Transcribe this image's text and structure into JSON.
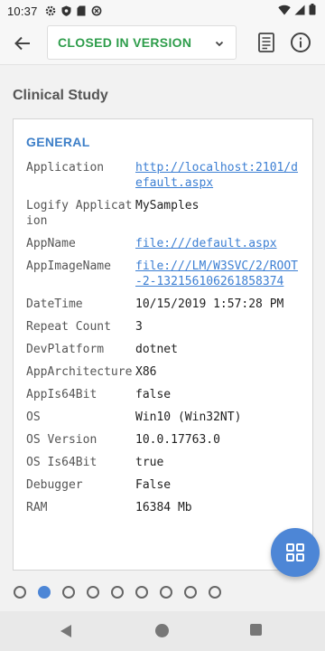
{
  "status_bar": {
    "time": "10:37",
    "icons": [
      "gear-icon",
      "shield-icon",
      "sd-card-icon",
      "data-saver-icon"
    ],
    "right_icons": [
      "wifi-icon",
      "signal-icon",
      "battery-icon"
    ]
  },
  "toolbar": {
    "back_icon": "arrow-back-icon",
    "status_selected": "CLOSED IN VERSION",
    "status_color": "#2e9d4b",
    "report_icon": "report-icon",
    "info_icon": "info-icon"
  },
  "page": {
    "title": "Clinical Study"
  },
  "general": {
    "title": "GENERAL",
    "rows": [
      {
        "key": "Application",
        "value": "http://localhost:2101/default.aspx",
        "link": true
      },
      {
        "key": "Logify Application",
        "value": "MySamples",
        "link": false
      },
      {
        "key": "AppName",
        "value": "file:///default.aspx",
        "link": true
      },
      {
        "key": "AppImageName",
        "value": "file:///LM/W3SVC/2/ROOT-2-132156106261858374",
        "link": true
      },
      {
        "key": "DateTime",
        "value": "10/15/2019 1:57:28 PM",
        "link": false
      },
      {
        "key": "Repeat Count",
        "value": "3",
        "link": false
      },
      {
        "key": "DevPlatform",
        "value": "dotnet",
        "link": false
      },
      {
        "key": "AppArchitecture",
        "value": "X86",
        "link": false
      },
      {
        "key": "AppIs64Bit",
        "value": "false",
        "link": false
      },
      {
        "key": "OS",
        "value": "Win10 (Win32NT)",
        "link": false
      },
      {
        "key": "OS Version",
        "value": "10.0.17763.0",
        "link": false
      },
      {
        "key": "OS Is64Bit",
        "value": "true",
        "link": false
      },
      {
        "key": "Debugger",
        "value": "False",
        "link": false
      },
      {
        "key": "RAM",
        "value": "16384 Mb",
        "link": false
      }
    ]
  },
  "fab": {
    "icon": "grid-apps-icon"
  },
  "pager": {
    "count": 9,
    "active_index": 1
  },
  "colors": {
    "accent": "#4d86d6",
    "link": "#3c7fd3",
    "section": "#3d7fc8"
  }
}
